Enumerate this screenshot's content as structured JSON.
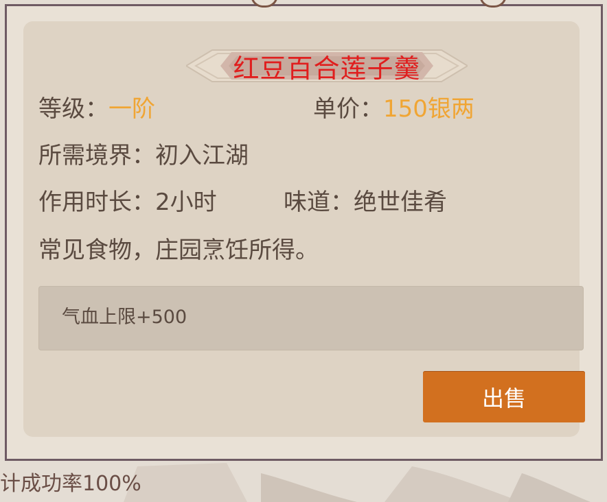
{
  "dialog": {
    "title": "红豆百合莲子羹",
    "level_label": "等级：",
    "level_value": "一阶",
    "price_label": "单价：",
    "price_value": "150银两",
    "realm_label": "所需境界：",
    "realm_value": "初入江湖",
    "duration_label": "作用时长：",
    "duration_value": "2小时",
    "taste_label": "味道：",
    "taste_value": "绝世佳肴",
    "description": "常见食物，庄园烹饪所得。",
    "effect": "气血上限+500",
    "sell_label": "出售"
  },
  "background": {
    "footer_text": "计成功率100%"
  },
  "colors": {
    "title": "#e01e1e",
    "highlight": "#f0a534",
    "button": "#d2701f",
    "frame": "#6e5a63"
  }
}
